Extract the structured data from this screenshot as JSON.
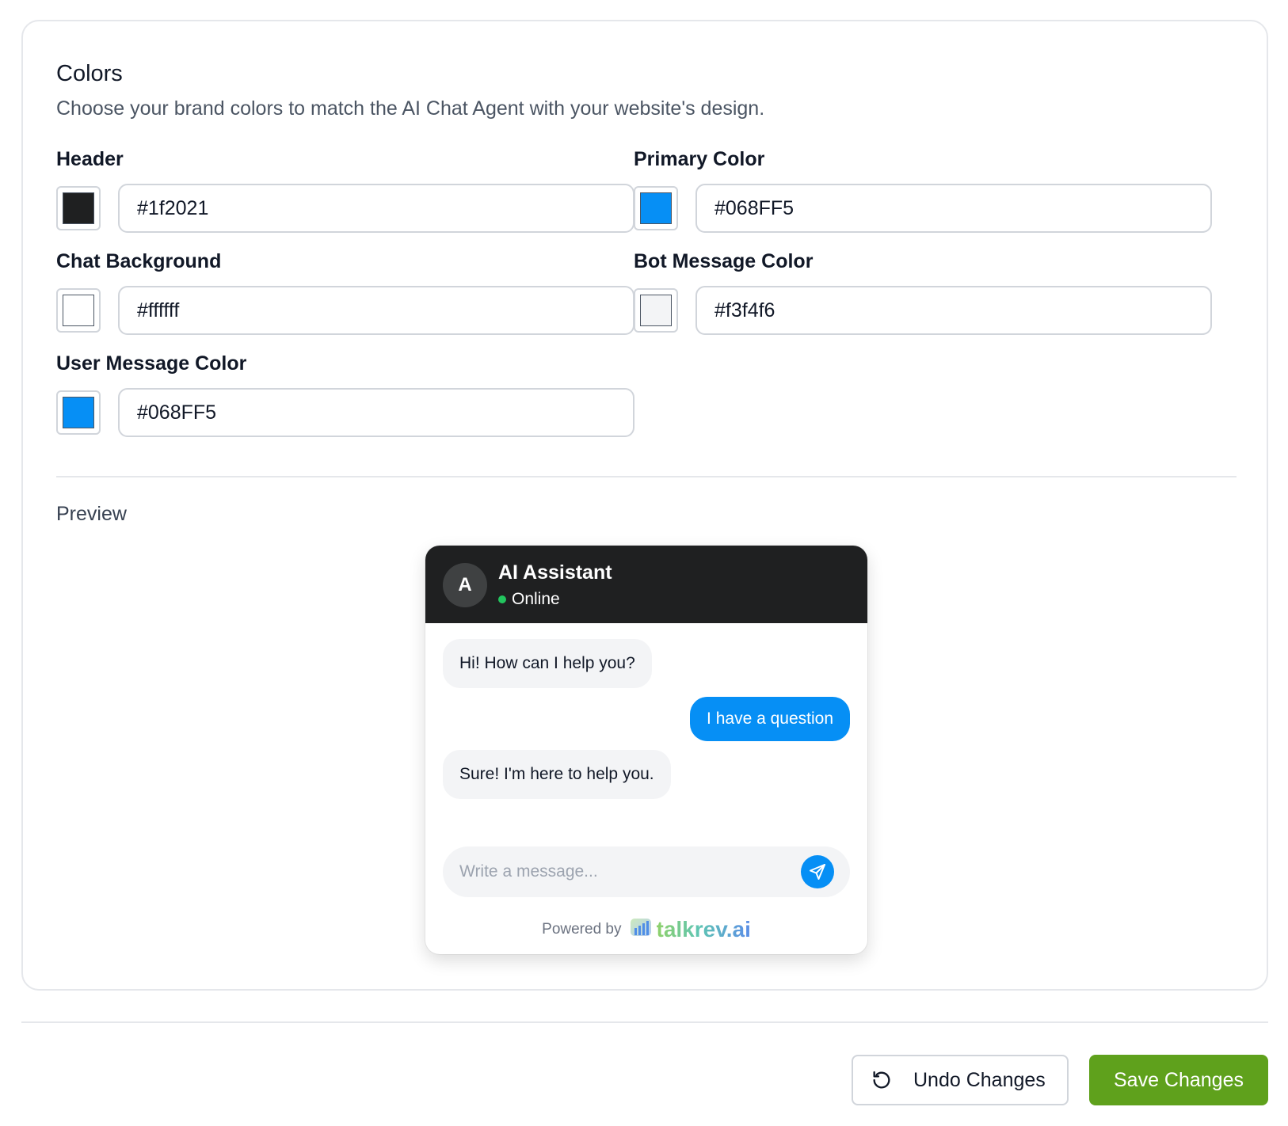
{
  "colors_section": {
    "title": "Colors",
    "description": "Choose your brand colors to match the AI Chat Agent with your website's design.",
    "fields": [
      {
        "id": "header",
        "label": "Header",
        "value": "#1f2021",
        "swatch": "#1f2021"
      },
      {
        "id": "primary",
        "label": "Primary Color",
        "value": "#068FF5",
        "swatch": "#068FF5"
      },
      {
        "id": "chat-background",
        "label": "Chat Background",
        "value": "#ffffff",
        "swatch": "#ffffff"
      },
      {
        "id": "bot-message",
        "label": "Bot Message Color",
        "value": "#f3f4f6",
        "swatch": "#f3f4f6"
      },
      {
        "id": "user-message",
        "label": "User Message Color",
        "value": "#068FF5",
        "swatch": "#068FF5"
      }
    ]
  },
  "preview": {
    "label": "Preview",
    "widget": {
      "avatar_letter": "A",
      "bot_name": "AI Assistant",
      "status": "Online",
      "messages": [
        {
          "from": "bot",
          "text": "Hi! How can I help you?"
        },
        {
          "from": "user",
          "text": "I have a question"
        },
        {
          "from": "bot",
          "text": "Sure! I'm here to help you."
        }
      ],
      "composer_placeholder": "Write a message...",
      "powered_by": "Powered by",
      "brand": "talkrev.ai"
    }
  },
  "actions": {
    "undo_label": "Undo Changes",
    "save_label": "Save Changes"
  },
  "icons": {
    "undo": "undo-icon",
    "send": "send-icon",
    "brand_logo": "talkrev-logo-icon"
  }
}
